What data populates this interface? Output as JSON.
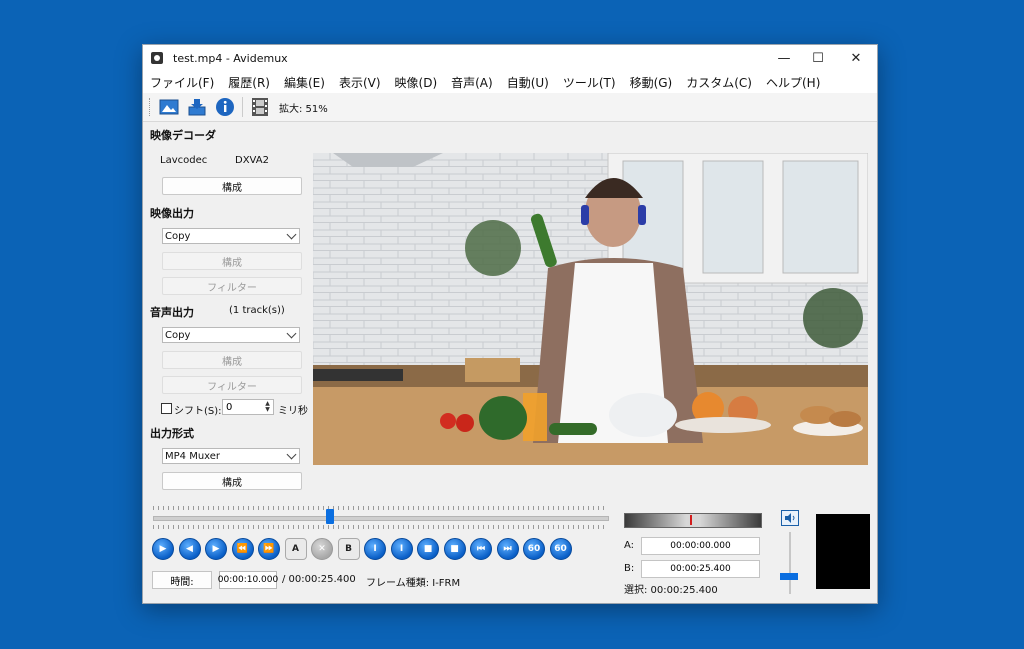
{
  "window": {
    "title": "test.mp4 - Avidemux",
    "minimize": "—",
    "maximize": "☐",
    "close": "✕"
  },
  "menu": [
    "ファイル(F)",
    "履歴(R)",
    "編集(E)",
    "表示(V)",
    "映像(D)",
    "音声(A)",
    "自動(U)",
    "ツール(T)",
    "移動(G)",
    "カスタム(C)",
    "ヘルプ(H)"
  ],
  "toolbar": {
    "zoom": "拡大: 51%"
  },
  "video_decoder": {
    "title": "映像デコーダ",
    "codec": "Lavcodec",
    "hw": "DXVA2",
    "configure": "構成"
  },
  "video_output": {
    "title": "映像出力",
    "selected": "Copy",
    "configure": "構成",
    "filters": "フィルター"
  },
  "audio_output": {
    "title": "音声出力",
    "tracks": "(1 track(s))",
    "selected": "Copy",
    "configure": "構成",
    "filters": "フィルター",
    "shift_label": "シフト(S):",
    "shift_value": "0",
    "shift_unit": "ミリ秒"
  },
  "output_format": {
    "title": "出力形式",
    "selected": "MP4 Muxer",
    "configure": "構成"
  },
  "playback": {
    "position": 0.39,
    "time_button": "時間:",
    "current_time": "00:00:10.000",
    "total_time": "/ 00:00:25.400",
    "frame_type": "フレーム種類: I-FRM"
  },
  "selection": {
    "a_label": "A:",
    "a_value": "00:00:00.000",
    "b_label": "B:",
    "b_value": "00:00:25.400",
    "selection_label": "選択: 00:00:25.400"
  },
  "control_buttons": [
    {
      "name": "play-button",
      "glyph": "▶"
    },
    {
      "name": "previous-frame-button",
      "glyph": "◀"
    },
    {
      "name": "next-frame-button",
      "glyph": "▶"
    },
    {
      "name": "rewind-button",
      "glyph": "⏪"
    },
    {
      "name": "fast-forward-button",
      "glyph": "⏩"
    },
    {
      "name": "set-marker-a-button",
      "glyph": "A"
    },
    {
      "name": "clear-markers-button",
      "glyph": "✕"
    },
    {
      "name": "set-marker-b-button",
      "glyph": "B"
    },
    {
      "name": "previous-keyframe-button",
      "glyph": "I"
    },
    {
      "name": "next-keyframe-button",
      "glyph": "I"
    },
    {
      "name": "previous-black-frame-button",
      "glyph": "■"
    },
    {
      "name": "next-black-frame-button",
      "glyph": "■"
    },
    {
      "name": "goto-start-button",
      "glyph": "⏮"
    },
    {
      "name": "goto-end-button",
      "glyph": "⏭"
    },
    {
      "name": "back-60s-button",
      "glyph": "60"
    },
    {
      "name": "forward-60s-button",
      "glyph": "60"
    }
  ],
  "volume": {
    "level": 0.3
  },
  "colors": {
    "desktop": "#0b63b6",
    "accent": "#0a6ee0"
  }
}
